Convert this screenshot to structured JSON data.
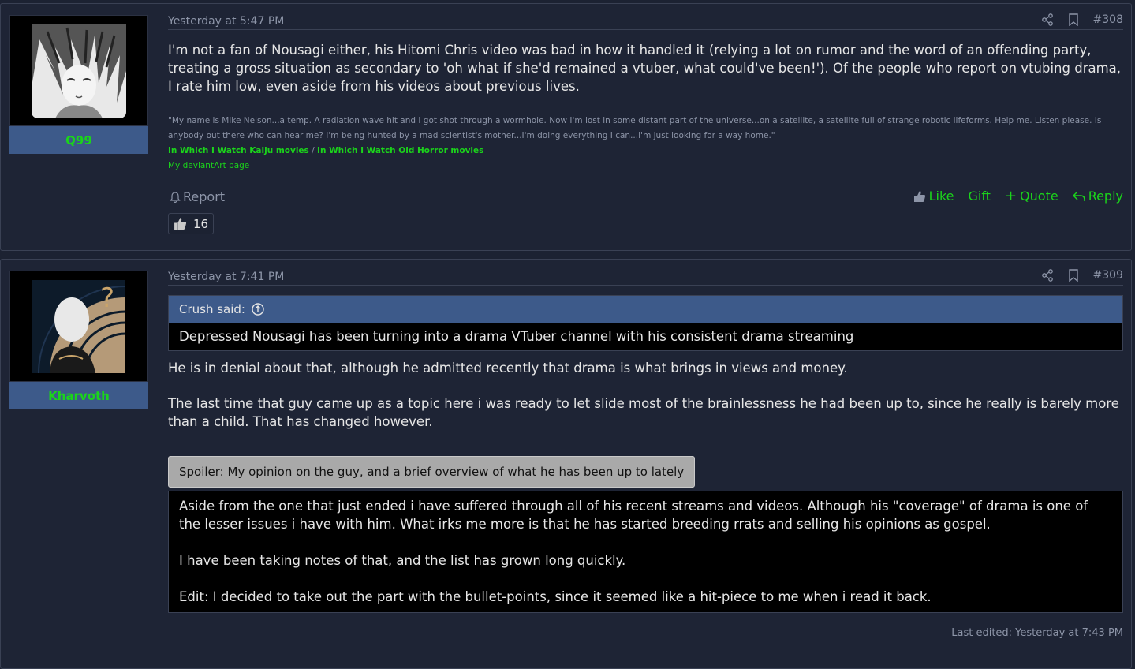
{
  "posts": [
    {
      "username": "Q99",
      "avatar_icon": "manga-portrait-avatar",
      "date": "Yesterday at 5:47 PM",
      "post_number": "#308",
      "body": "I'm not a fan of Nousagi either, his Hitomi Chris video was bad in how it handled it (relying a lot on rumor and the word of an offending party, treating a gross situation as secondary to 'oh what if she'd remained a vtuber, what could've been!'). Of the people who report on vtubing drama, I rate him low, even aside from his videos about previous lives.",
      "signature": {
        "quote": "\"My name is Mike Nelson...a temp. A radiation wave hit and I got shot through a wormhole. Now I'm lost in some distant part of the universe...on a satellite, a satellite full of strange robotic lifeforms. Help me. Listen please. Is anybody out there who can hear me? I'm being hunted by a mad scientist's mother...I'm doing everything I can...I'm just looking for a way home.\"",
        "link1": "In Which I Watch Kaiju movies",
        "separator": " / ",
        "link2": "In Which I Watch Old Horror movies",
        "link3": "My deviantArt page"
      },
      "actions": {
        "report": "Report",
        "like": "Like",
        "gift": "Gift",
        "quote": "Quote",
        "reply": "Reply"
      },
      "reaction_count": "16"
    },
    {
      "username": "Kharvoth",
      "avatar_icon": "silhouette-question-avatar",
      "date": "Yesterday at 7:41 PM",
      "post_number": "#309",
      "quote_author": "Crush said:",
      "quote_text": "Depressed Nousagi has been turning into a drama VTuber channel with his consistent drama streaming",
      "para1": "He is in denial about that, although he admitted recently that drama is what brings in views and money.",
      "para2": "The last time that guy came up as a topic here i was ready to let slide most of the brainlessness he had been up to, since he really is barely more than a child. That has changed however.",
      "spoiler_label": "Spoiler: My opinion on the guy, and a brief overview of what he has been up to lately",
      "spoiler_p1": "Aside from the one that just ended i have suffered through all of his recent streams and videos. Although his \"coverage\" of drama is one of the lesser issues i have with him. What irks me more is that he has started breeding rrats and selling his opinions as gospel.",
      "spoiler_p2": "I have been taking notes of that, and the list has grown long quickly.",
      "spoiler_p3": "Edit: I decided to take out the part with the bullet-points, since it seemed like a hit-piece to me when i read it back.",
      "last_edited": "Last edited: Yesterday at 7:43 PM"
    }
  ],
  "colors": {
    "accent_green": "#1bd41b",
    "user_bar": "#3d5a8a",
    "background": "#1e2435"
  }
}
